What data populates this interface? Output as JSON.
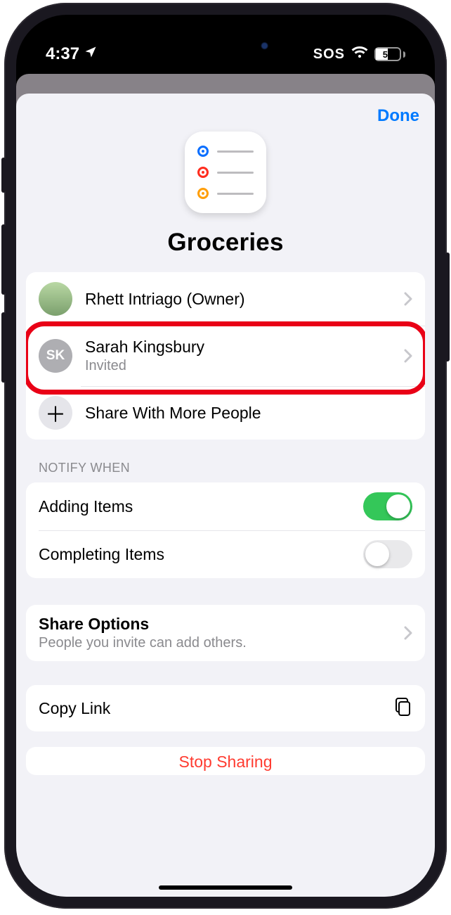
{
  "status": {
    "time": "4:37",
    "sos": "SOS",
    "battery": "51"
  },
  "nav": {
    "done": "Done"
  },
  "header": {
    "title": "Groceries"
  },
  "people": {
    "owner": {
      "name": "Rhett Intriago (Owner)"
    },
    "invitee": {
      "name": "Sarah Kingsbury",
      "status": "Invited",
      "initials": "SK"
    },
    "share_more": "Share With More People"
  },
  "notify": {
    "section": "Notify When",
    "adding": "Adding Items",
    "completing": "Completing Items"
  },
  "share_options": {
    "title": "Share Options",
    "subtitle": "People you invite can add others."
  },
  "copy_link": "Copy Link",
  "stop_sharing": "Stop Sharing"
}
